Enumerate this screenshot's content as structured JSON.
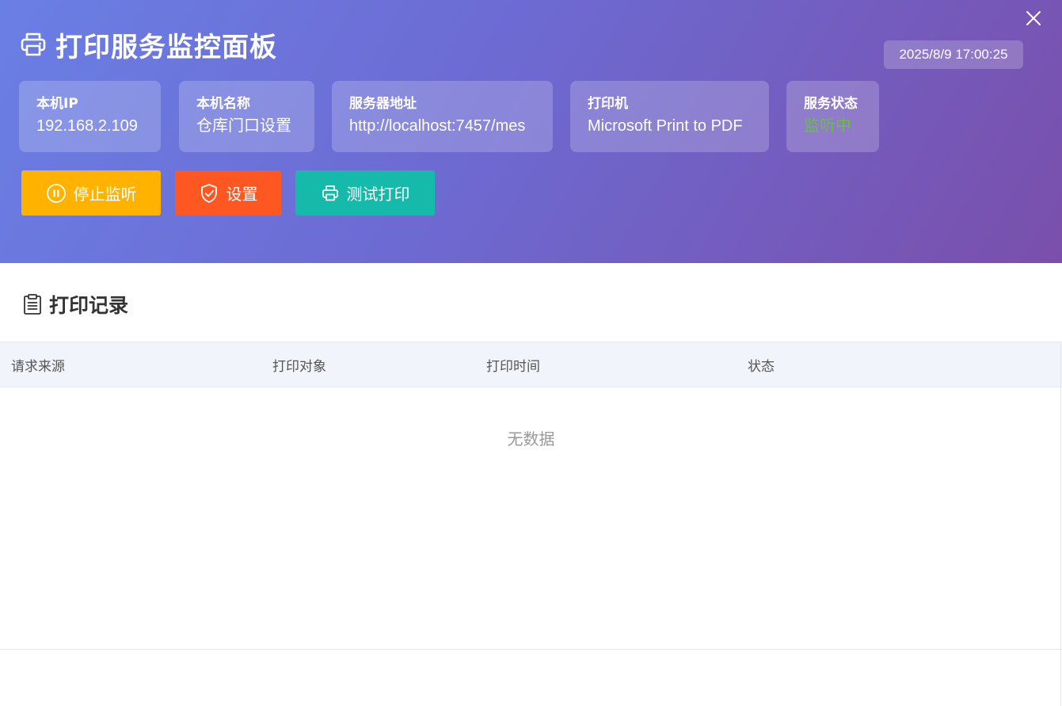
{
  "header": {
    "title": "打印服务监控面板",
    "datetime": "2025/8/9 17:00:25",
    "icons": {
      "title": "printer-icon",
      "close": "close-icon"
    }
  },
  "info_cards": [
    {
      "label": "本机IP",
      "value": "192.168.2.109"
    },
    {
      "label": "本机名称",
      "value": "仓库门口设置"
    },
    {
      "label": "服务器地址",
      "value": "http://localhost:7457/mes"
    },
    {
      "label": "打印机",
      "value": "Microsoft Print to PDF"
    },
    {
      "label": "服务状态",
      "value": "监听中"
    }
  ],
  "status_color": "#67c23a",
  "actions": {
    "stop": {
      "label": "停止监听",
      "icon": "pause-circle-icon",
      "color": "#ffb300"
    },
    "settings": {
      "label": "设置",
      "icon": "shield-check-icon",
      "color": "#ff5722"
    },
    "test": {
      "label": "测试打印",
      "icon": "printer-icon",
      "color": "#16baaa"
    }
  },
  "records": {
    "title": "打印记录",
    "icon": "clipboard-icon",
    "columns": [
      "请求来源",
      "打印对象",
      "打印时间",
      "状态"
    ],
    "rows": [],
    "empty_text": "无数据"
  }
}
